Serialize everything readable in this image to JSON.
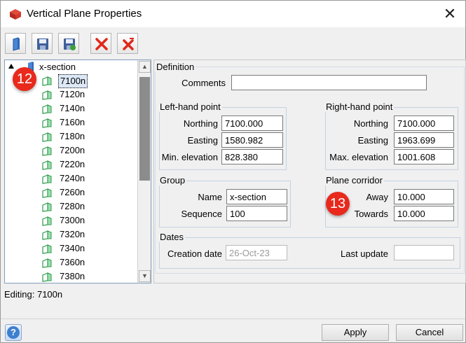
{
  "window": {
    "title": "Vertical Plane Properties",
    "close_glyph": "✕"
  },
  "toolbar": {
    "buttons": [
      "new-icon",
      "save-icon",
      "save-as-icon",
      "delete-icon",
      "delete-all-icon"
    ]
  },
  "tree": {
    "root": "x-section",
    "items": [
      "7100n",
      "7120n",
      "7140n",
      "7160n",
      "7180n",
      "7200n",
      "7220n",
      "7240n",
      "7260n",
      "7280n",
      "7300n",
      "7320n",
      "7340n",
      "7360n",
      "7380n"
    ],
    "selected": "7100n"
  },
  "definition": {
    "title": "Definition",
    "comments_label": "Comments",
    "comments_value": ""
  },
  "left_point": {
    "title": "Left-hand point",
    "northing_label": "Northing",
    "northing": "7100.000",
    "easting_label": "Easting",
    "easting": "1580.982",
    "elev_label": "Min. elevation",
    "elev": "828.380"
  },
  "right_point": {
    "title": "Right-hand point",
    "northing_label": "Northing",
    "northing": "7100.000",
    "easting_label": "Easting",
    "easting": "1963.699",
    "elev_label": "Max. elevation",
    "elev": "1001.608"
  },
  "group": {
    "title": "Group",
    "name_label": "Name",
    "name": "x-section",
    "sequence_label": "Sequence",
    "sequence": "100"
  },
  "corridor": {
    "title": "Plane corridor",
    "away_label": "Away",
    "away": "10.000",
    "towards_label": "Towards",
    "towards": "10.000"
  },
  "dates": {
    "title": "Dates",
    "creation_label": "Creation date",
    "creation": "26-Oct-23",
    "update_label": "Last update",
    "update": ""
  },
  "status": {
    "text": "Editing:  7100n"
  },
  "footer": {
    "apply": "Apply",
    "cancel": "Cancel",
    "help_glyph": "?"
  },
  "annotations": {
    "badge1": "12",
    "badge2": "13",
    "color": "#e8291c"
  }
}
